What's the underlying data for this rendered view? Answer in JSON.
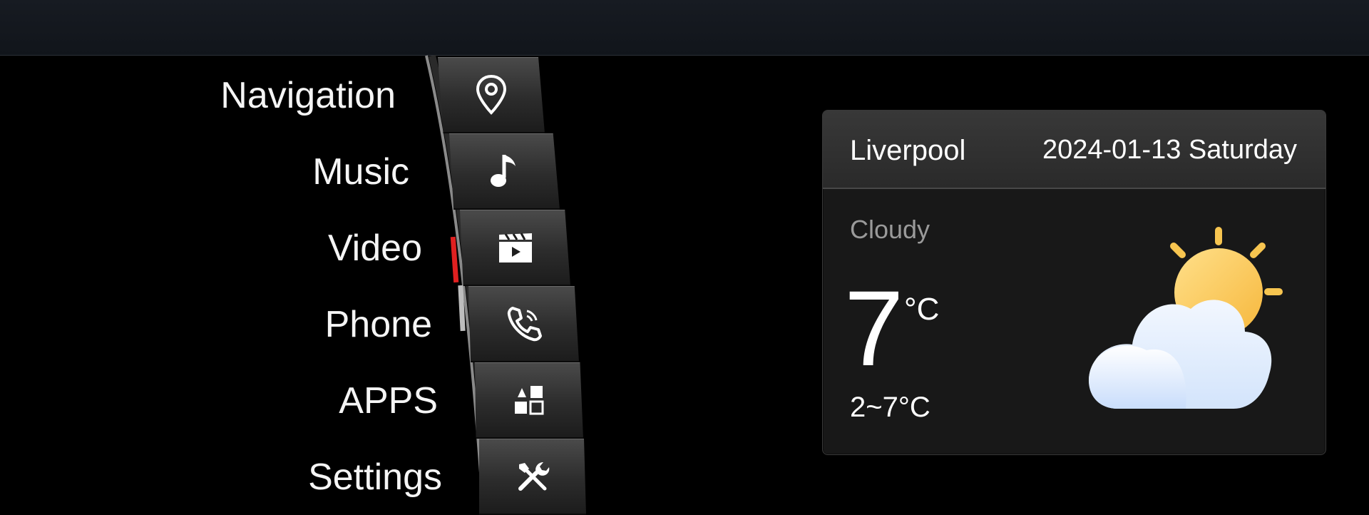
{
  "menu": {
    "items": [
      {
        "label": "Navigation",
        "icon": "map-pin-icon"
      },
      {
        "label": "Music",
        "icon": "music-note-icon"
      },
      {
        "label": "Video",
        "icon": "clapperboard-icon"
      },
      {
        "label": "Phone",
        "icon": "phone-icon"
      },
      {
        "label": "APPS",
        "icon": "apps-grid-icon"
      },
      {
        "label": "Settings",
        "icon": "tools-icon"
      }
    ],
    "active_item": "Video",
    "accent_color": "#e02020"
  },
  "weather": {
    "city": "Liverpool",
    "date": "2024-01-13 Saturday",
    "condition": "Cloudy",
    "temperature": "7",
    "unit": "°C",
    "range": "2~7°C",
    "icon": "partly-cloudy-icon"
  }
}
